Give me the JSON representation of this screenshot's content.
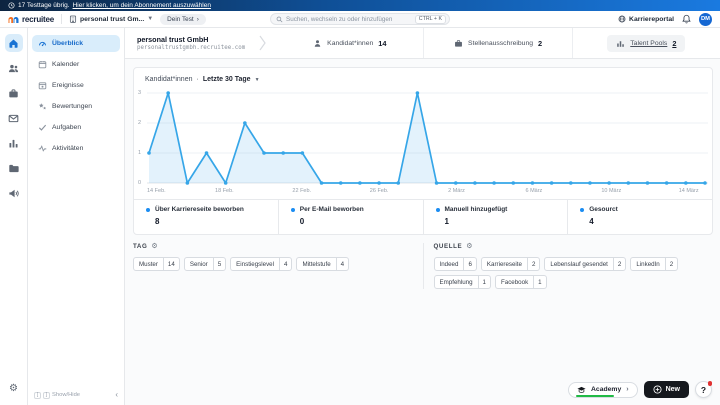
{
  "promo_bar": {
    "text": "17 Testtage übrig.",
    "link": "Hier klicken, um dein Abonnement auszuwählen"
  },
  "header": {
    "logo_text": "recruitee",
    "org_switcher": "personal trust Gm...",
    "pipeline_pill": "Dein Test",
    "pipeline_chevron": "›",
    "search": {
      "placeholder": "Suchen, wechseln zu oder hinzufügen",
      "shortcut": "CTRL + K"
    },
    "career_portal": "Karriereportal",
    "avatar_initials": "DM"
  },
  "icon_rail": {
    "items": [
      {
        "icon": "home-icon",
        "active": true
      },
      {
        "icon": "candidates-icon",
        "active": false
      },
      {
        "icon": "jobs-icon",
        "active": false
      },
      {
        "icon": "inbox-icon",
        "active": false
      },
      {
        "icon": "reports-icon",
        "active": false
      },
      {
        "icon": "folder-icon",
        "active": false
      },
      {
        "icon": "campaigns-icon",
        "active": false
      }
    ],
    "bottom_icon": "settings-gear-icon",
    "gear_glyph": "⚙"
  },
  "sidebar": {
    "items": [
      {
        "label": "Überblick",
        "icon": "overview-gauge-icon",
        "active": true
      },
      {
        "label": "Kalender",
        "icon": "calendar-icon",
        "active": false
      },
      {
        "label": "Ereignisse",
        "icon": "events-icon",
        "active": false
      },
      {
        "label": "Bewertungen",
        "icon": "reviews-icon",
        "active": false
      },
      {
        "label": "Aufgaben",
        "icon": "tasks-check-icon",
        "active": false
      },
      {
        "label": "Aktivitäten",
        "icon": "activities-icon",
        "active": false
      }
    ],
    "showhide": {
      "key_left": "[",
      "key_right": "]",
      "label": "Show/Hide",
      "collapse": "‹"
    }
  },
  "company": {
    "name": "personal trust GmbH",
    "domain": "personaltrustgmbh.recruitee.com"
  },
  "tabs": [
    {
      "label": "Kandidat*innen",
      "count": "14",
      "icon": "person-icon",
      "highlighted": false
    },
    {
      "label": "Stellenausschreibung",
      "count": "2",
      "icon": "briefcase-icon",
      "highlighted": false
    },
    {
      "label": "Talent Pools",
      "count": "2",
      "icon": "pools-chart-icon",
      "highlighted": true
    }
  ],
  "chart_card": {
    "title": "Kandidat*innen",
    "separator": "·",
    "range": "Letzte 30 Tage",
    "dropdown_caret": "▼"
  },
  "chart_data": {
    "type": "area",
    "title": "Kandidat*innen — Letzte 30 Tage",
    "n_points": 30,
    "values": [
      1,
      3,
      0,
      1,
      0,
      2,
      1,
      1,
      1,
      0,
      0,
      0,
      0,
      0,
      3,
      0,
      0,
      0,
      0,
      0,
      0,
      0,
      0,
      0,
      0,
      0,
      0,
      0,
      0,
      0
    ],
    "x_ticks": [
      {
        "index": 0,
        "label": "14 Feb."
      },
      {
        "index": 4,
        "label": "18 Feb."
      },
      {
        "index": 8,
        "label": "22 Feb."
      },
      {
        "index": 12,
        "label": "26 Feb."
      },
      {
        "index": 16,
        "label": "2 März"
      },
      {
        "index": 20,
        "label": "6 März"
      },
      {
        "index": 24,
        "label": "10 März"
      },
      {
        "index": 28,
        "label": "14 März"
      }
    ],
    "yticks": [
      0,
      1,
      2,
      3
    ],
    "ylim": [
      0,
      3
    ],
    "grid": "on",
    "line_color": "#36a6e8",
    "fill_color": "rgba(54,166,232,0.14)",
    "legend_position": "none"
  },
  "stats": [
    {
      "label": "Über Karriereseite beworben",
      "value": "8"
    },
    {
      "label": "Per E-Mail beworben",
      "value": "0"
    },
    {
      "label": "Manuell hinzugefügt",
      "value": "1"
    },
    {
      "label": "Gesourct",
      "value": "4"
    }
  ],
  "tags": {
    "title": "TAG",
    "chips": [
      {
        "label": "Muster",
        "count": "14"
      },
      {
        "label": "Senior",
        "count": "5"
      },
      {
        "label": "Einstiegslevel",
        "count": "4"
      },
      {
        "label": "Mittelstufe",
        "count": "4"
      }
    ]
  },
  "sources": {
    "title": "QUELLE",
    "chips": [
      {
        "label": "Indeed",
        "count": "6"
      },
      {
        "label": "Karriereseite",
        "count": "2"
      },
      {
        "label": "Lebenslauf gesendet",
        "count": "2"
      },
      {
        "label": "LinkedIn",
        "count": "2"
      },
      {
        "label": "Empfehlung",
        "count": "1"
      },
      {
        "label": "Facebook",
        "count": "1"
      }
    ]
  },
  "floats": {
    "academy": "Academy",
    "academy_chevron": "›",
    "new_button": "New",
    "help": "?"
  },
  "colors": {
    "accent_blue": "#1a73d3",
    "chart_line": "#36a6e8",
    "stat_dot": "#1b8df2",
    "promo_gradient_start": "#0d2440",
    "promo_gradient_end": "#1a7ae0",
    "avatar_bg": "#1568d3",
    "academy_progress": "#21ba45",
    "new_button_bg": "#15181d",
    "notification_red": "#e03131"
  }
}
